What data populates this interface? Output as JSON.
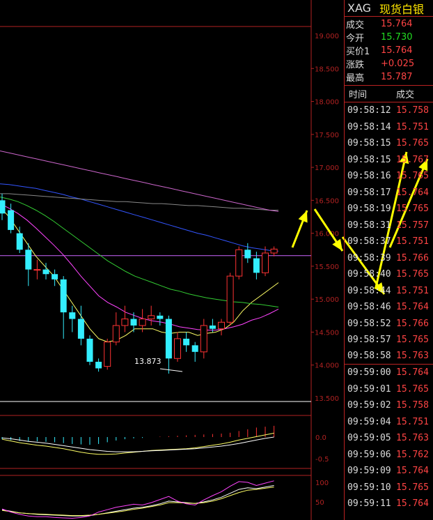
{
  "chart_data": {
    "type": "candlestick",
    "instrument": {
      "code": "XAG",
      "name": "现货白银"
    },
    "y_ticks": [
      "19.000",
      "18.500",
      "18.000",
      "17.500",
      "17.000",
      "16.500",
      "16.000",
      "15.500",
      "15.000",
      "14.500",
      "14.000",
      "13.500"
    ],
    "ylim": [
      13.5,
      19.0
    ],
    "low_annotation": "13.873",
    "horizontal_line": 15.66,
    "candles": [
      {
        "o": 16.5,
        "h": 16.6,
        "l": 16.2,
        "c": 16.3
      },
      {
        "o": 16.35,
        "h": 16.45,
        "l": 16.0,
        "c": 16.05
      },
      {
        "o": 16.0,
        "h": 16.1,
        "l": 15.7,
        "c": 15.75
      },
      {
        "o": 15.75,
        "h": 15.85,
        "l": 15.2,
        "c": 15.45
      },
      {
        "o": 15.45,
        "h": 15.6,
        "l": 15.3,
        "c": 15.45
      },
      {
        "o": 15.45,
        "h": 15.55,
        "l": 15.3,
        "c": 15.38
      },
      {
        "o": 15.38,
        "h": 15.45,
        "l": 15.2,
        "c": 15.3
      },
      {
        "o": 15.3,
        "h": 15.35,
        "l": 14.4,
        "c": 14.8
      },
      {
        "o": 14.8,
        "h": 14.9,
        "l": 14.5,
        "c": 14.7
      },
      {
        "o": 14.7,
        "h": 14.9,
        "l": 14.3,
        "c": 14.4
      },
      {
        "o": 14.4,
        "h": 14.45,
        "l": 14.0,
        "c": 14.05
      },
      {
        "o": 14.05,
        "h": 14.1,
        "l": 13.9,
        "c": 13.95
      },
      {
        "o": 13.98,
        "h": 14.4,
        "l": 13.93,
        "c": 14.35
      },
      {
        "o": 14.35,
        "h": 14.8,
        "l": 14.3,
        "c": 14.6
      },
      {
        "o": 14.6,
        "h": 14.9,
        "l": 14.5,
        "c": 14.7
      },
      {
        "o": 14.7,
        "h": 14.8,
        "l": 14.5,
        "c": 14.6
      },
      {
        "o": 14.6,
        "h": 14.85,
        "l": 14.5,
        "c": 14.7
      },
      {
        "o": 14.7,
        "h": 14.9,
        "l": 14.6,
        "c": 14.75
      },
      {
        "o": 14.75,
        "h": 14.8,
        "l": 14.6,
        "c": 14.7
      },
      {
        "o": 14.7,
        "h": 14.75,
        "l": 13.87,
        "c": 14.1
      },
      {
        "o": 14.1,
        "h": 14.5,
        "l": 14.05,
        "c": 14.4
      },
      {
        "o": 14.4,
        "h": 14.5,
        "l": 14.2,
        "c": 14.3
      },
      {
        "o": 14.3,
        "h": 14.35,
        "l": 14.05,
        "c": 14.2
      },
      {
        "o": 14.2,
        "h": 14.7,
        "l": 14.1,
        "c": 14.6
      },
      {
        "o": 14.6,
        "h": 14.7,
        "l": 14.5,
        "c": 14.55
      },
      {
        "o": 14.55,
        "h": 14.7,
        "l": 14.45,
        "c": 14.65
      },
      {
        "o": 14.65,
        "h": 15.4,
        "l": 14.6,
        "c": 15.35
      },
      {
        "o": 15.35,
        "h": 15.8,
        "l": 15.3,
        "c": 15.75
      },
      {
        "o": 15.75,
        "h": 15.85,
        "l": 15.55,
        "c": 15.62
      },
      {
        "o": 15.62,
        "h": 15.72,
        "l": 15.3,
        "c": 15.4
      },
      {
        "o": 15.4,
        "h": 15.8,
        "l": 15.35,
        "c": 15.7
      },
      {
        "o": 15.7,
        "h": 15.8,
        "l": 15.65,
        "c": 15.76
      }
    ],
    "ma_lines": [
      {
        "color": "#ffff66",
        "values": [
          16.4,
          16.25,
          16.05,
          15.85,
          15.65,
          15.5,
          15.35,
          15.15,
          14.95,
          14.75,
          14.55,
          14.4,
          14.35,
          14.38,
          14.45,
          14.55,
          14.55,
          14.55,
          14.5,
          14.48,
          14.5,
          14.5,
          14.45,
          14.48,
          14.5,
          14.55,
          14.65,
          14.82,
          14.95,
          15.05,
          15.15,
          15.25
        ]
      },
      {
        "color": "#ff44ff",
        "values": [
          16.45,
          16.38,
          16.3,
          16.2,
          16.08,
          15.95,
          15.82,
          15.68,
          15.52,
          15.35,
          15.2,
          15.05,
          14.95,
          14.88,
          14.8,
          14.75,
          14.7,
          14.67,
          14.65,
          14.62,
          14.58,
          14.56,
          14.54,
          14.53,
          14.53,
          14.55,
          14.58,
          14.62,
          14.68,
          14.72,
          14.78,
          14.85
        ]
      },
      {
        "color": "#33cc33",
        "values": [
          16.55,
          16.52,
          16.48,
          16.42,
          16.35,
          16.27,
          16.18,
          16.08,
          15.98,
          15.88,
          15.78,
          15.68,
          15.58,
          15.5,
          15.42,
          15.35,
          15.3,
          15.25,
          15.2,
          15.15,
          15.12,
          15.08,
          15.05,
          15.02,
          15.0,
          14.98,
          14.96,
          14.95,
          14.93,
          14.92,
          14.9,
          14.88
        ]
      },
      {
        "color": "#3355ff",
        "values": [
          16.75,
          16.74,
          16.72,
          16.7,
          16.68,
          16.65,
          16.62,
          16.59,
          16.55,
          16.52,
          16.48,
          16.44,
          16.4,
          16.36,
          16.32,
          16.28,
          16.24,
          16.2,
          16.16,
          16.12,
          16.08,
          16.04,
          16.0,
          15.97,
          15.93,
          15.89,
          15.85,
          15.81,
          15.78,
          15.76,
          15.74,
          15.73
        ]
      },
      {
        "color": "#888888",
        "values": [
          16.6,
          16.6,
          16.59,
          16.58,
          16.57,
          16.56,
          16.55,
          16.54,
          16.53,
          16.52,
          16.51,
          16.5,
          16.49,
          16.48,
          16.48,
          16.47,
          16.46,
          16.45,
          16.45,
          16.44,
          16.43,
          16.42,
          16.42,
          16.41,
          16.4,
          16.39,
          16.38,
          16.38,
          16.37,
          16.36,
          16.35,
          16.35
        ]
      },
      {
        "color": "#cc66cc",
        "values": [
          17.25,
          17.22,
          17.19,
          17.16,
          17.13,
          17.1,
          17.07,
          17.04,
          17.01,
          16.98,
          16.95,
          16.92,
          16.89,
          16.86,
          16.83,
          16.8,
          16.77,
          16.74,
          16.71,
          16.68,
          16.65,
          16.62,
          16.59,
          16.56,
          16.53,
          16.5,
          16.47,
          16.44,
          16.41,
          16.38,
          16.35,
          16.33
        ]
      }
    ],
    "macd_ticks": [
      "0.0",
      "-0.5"
    ],
    "macd_bars": [
      -0.05,
      -0.07,
      -0.09,
      -0.1,
      -0.1,
      -0.11,
      -0.12,
      -0.14,
      -0.16,
      -0.17,
      -0.18,
      -0.16,
      -0.12,
      -0.08,
      -0.05,
      -0.03,
      -0.02,
      0.0,
      0.01,
      0.02,
      0.03,
      0.04,
      0.05,
      0.06,
      0.07,
      0.08,
      0.1,
      0.14,
      0.18,
      0.22,
      0.24,
      0.26
    ],
    "macd_lines": [
      {
        "color": "#ffff66",
        "values": [
          -0.05,
          -0.09,
          -0.13,
          -0.16,
          -0.19,
          -0.21,
          -0.24,
          -0.27,
          -0.31,
          -0.35,
          -0.38,
          -0.4,
          -0.4,
          -0.39,
          -0.37,
          -0.35,
          -0.33,
          -0.31,
          -0.3,
          -0.29,
          -0.28,
          -0.27,
          -0.25,
          -0.22,
          -0.19,
          -0.16,
          -0.12,
          -0.07,
          -0.03,
          0.01,
          0.05,
          0.09
        ]
      },
      {
        "color": "#ffffff",
        "values": [
          -0.02,
          -0.04,
          -0.07,
          -0.1,
          -0.12,
          -0.14,
          -0.17,
          -0.2,
          -0.23,
          -0.26,
          -0.29,
          -0.31,
          -0.33,
          -0.34,
          -0.34,
          -0.34,
          -0.33,
          -0.32,
          -0.31,
          -0.3,
          -0.29,
          -0.28,
          -0.27,
          -0.25,
          -0.23,
          -0.21,
          -0.18,
          -0.15,
          -0.11,
          -0.07,
          -0.03,
          0.0
        ]
      }
    ],
    "kdj_ticks": [
      "100",
      "50"
    ],
    "kdj_lines": [
      {
        "color": "#ffffff",
        "values": [
          30,
          26,
          22,
          20,
          18,
          17,
          16,
          15,
          14,
          14,
          15,
          18,
          22,
          26,
          30,
          34,
          36,
          40,
          45,
          52,
          50,
          48,
          46,
          50,
          55,
          62,
          72,
          82,
          86,
          84,
          88,
          92
        ]
      },
      {
        "color": "#ffff66",
        "values": [
          28,
          25,
          22,
          20,
          19,
          18,
          17,
          16,
          15,
          15,
          16,
          18,
          21,
          24,
          27,
          31,
          34,
          38,
          42,
          48,
          48,
          47,
          46,
          48,
          52,
          58,
          66,
          74,
          80,
          82,
          85,
          88
        ]
      },
      {
        "color": "#ff44ff",
        "values": [
          32,
          24,
          18,
          14,
          12,
          12,
          10,
          9,
          8,
          10,
          14,
          24,
          30,
          36,
          40,
          44,
          42,
          48,
          56,
          64,
          52,
          45,
          42,
          55,
          66,
          76,
          90,
          102,
          100,
          92,
          98,
          104
        ]
      }
    ]
  },
  "quote": {
    "rows": [
      {
        "label": "成交",
        "value": "15.764",
        "color": "red"
      },
      {
        "label": "今开",
        "value": "15.730",
        "color": "green"
      },
      {
        "label": "买价1",
        "value": "15.764",
        "color": "red"
      },
      {
        "label": "涨跌",
        "value": "+0.025",
        "color": "red"
      },
      {
        "label": "最高",
        "value": "15.787",
        "color": "red"
      }
    ],
    "ticks_header": {
      "time": "时间",
      "price": "成交"
    },
    "ticks": [
      {
        "time": "09:58:12",
        "price": "15.758"
      },
      {
        "time": "09:58:14",
        "price": "15.751"
      },
      {
        "time": "09:58:15",
        "price": "15.765"
      },
      {
        "time": "09:58:15",
        "price": "15.767"
      },
      {
        "time": "09:58:16",
        "price": "15.765"
      },
      {
        "time": "09:58:17",
        "price": "15.764"
      },
      {
        "time": "09:58:19",
        "price": "15.765"
      },
      {
        "time": "09:58:31",
        "price": "15.757"
      },
      {
        "time": "09:58:37",
        "price": "15.751"
      },
      {
        "time": "09:58:39",
        "price": "15.766"
      },
      {
        "time": "09:58:40",
        "price": "15.765"
      },
      {
        "time": "09:58:44",
        "price": "15.751"
      },
      {
        "time": "09:58:46",
        "price": "15.764"
      },
      {
        "time": "09:58:52",
        "price": "15.766"
      },
      {
        "time": "09:58:57",
        "price": "15.765"
      },
      {
        "time": "09:58:58",
        "price": "15.763"
      },
      {
        "time": "09:59:00",
        "price": "15.764"
      },
      {
        "time": "09:59:01",
        "price": "15.765"
      },
      {
        "time": "09:59:02",
        "price": "15.758"
      },
      {
        "time": "09:59:04",
        "price": "15.751"
      },
      {
        "time": "09:59:05",
        "price": "15.763"
      },
      {
        "time": "09:59:06",
        "price": "15.762"
      },
      {
        "time": "09:59:09",
        "price": "15.764"
      },
      {
        "time": "09:59:10",
        "price": "15.765"
      },
      {
        "time": "09:59:11",
        "price": "15.764"
      }
    ]
  },
  "colors": {
    "up": "#ff3333",
    "down": "#33eeff",
    "grid": "#b22222",
    "hline": "#cc66ff",
    "arrow": "#ffff00"
  }
}
